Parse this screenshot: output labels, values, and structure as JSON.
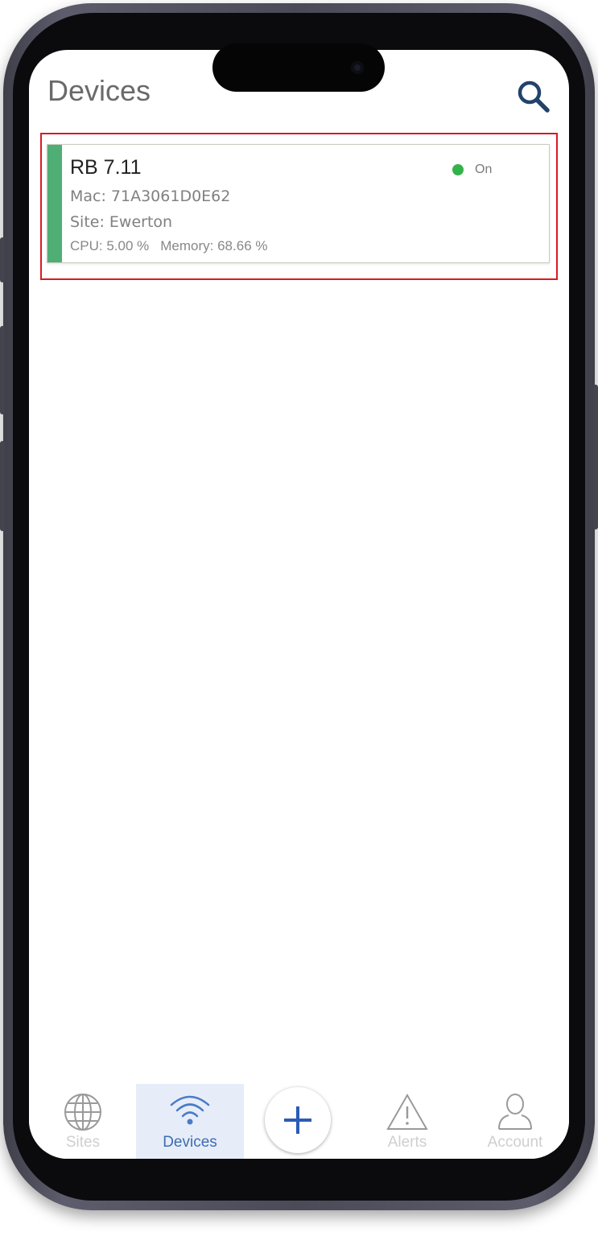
{
  "header": {
    "title": "Devices"
  },
  "device": {
    "name": "RB 7.11",
    "status": "On",
    "mac": "Mac: 71A3061D0E62",
    "site": "Site: Ewerton",
    "cpu": "CPU: 5.00 %",
    "memory": "Memory: 68.66 %"
  },
  "nav": {
    "items": [
      {
        "label": "Sites",
        "icon": "globe-icon",
        "active": false
      },
      {
        "label": "Devices",
        "icon": "wifi-icon",
        "active": true
      },
      {
        "label": "",
        "icon": "plus-icon",
        "active": false
      },
      {
        "label": "Alerts",
        "icon": "alert-triangle-icon",
        "active": false
      },
      {
        "label": "Account",
        "icon": "user-icon",
        "active": false
      }
    ]
  },
  "colors": {
    "accent_green": "#4fae74",
    "status_on": "#33b24a",
    "highlight_red": "#d81a23",
    "active_blue": "#3d6cb4",
    "active_tab_bg": "#e6edf8"
  }
}
